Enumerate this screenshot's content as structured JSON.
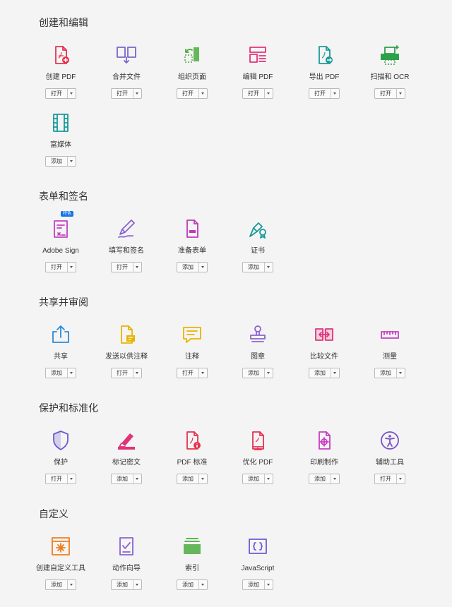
{
  "sections": [
    {
      "title": "创建和编辑",
      "tools": [
        {
          "label": "创建 PDF",
          "action": "打开",
          "icon": "create-pdf-icon"
        },
        {
          "label": "合并文件",
          "action": "打开",
          "icon": "combine-files-icon"
        },
        {
          "label": "组织页面",
          "action": "打开",
          "icon": "organize-pages-icon"
        },
        {
          "label": "编辑 PDF",
          "action": "打开",
          "icon": "edit-pdf-icon"
        },
        {
          "label": "导出 PDF",
          "action": "打开",
          "icon": "export-pdf-icon"
        },
        {
          "label": "扫描和 OCR",
          "action": "打开",
          "icon": "scan-ocr-icon"
        },
        {
          "label": "富媒体",
          "action": "添加",
          "icon": "rich-media-icon"
        }
      ]
    },
    {
      "title": "表单和签名",
      "tools": [
        {
          "label": "Adobe Sign",
          "action": "打开",
          "icon": "adobe-sign-icon",
          "badge": "特色"
        },
        {
          "label": "填写和签名",
          "action": "打开",
          "icon": "fill-sign-icon"
        },
        {
          "label": "准备表单",
          "action": "添加",
          "icon": "prepare-form-icon"
        },
        {
          "label": "证书",
          "action": "添加",
          "icon": "certificate-icon"
        }
      ]
    },
    {
      "title": "共享并审阅",
      "tools": [
        {
          "label": "共享",
          "action": "添加",
          "icon": "share-icon"
        },
        {
          "label": "发送以供注释",
          "action": "打开",
          "icon": "send-comments-icon"
        },
        {
          "label": "注释",
          "action": "打开",
          "icon": "comment-icon"
        },
        {
          "label": "图章",
          "action": "添加",
          "icon": "stamp-icon"
        },
        {
          "label": "比较文件",
          "action": "添加",
          "icon": "compare-files-icon"
        },
        {
          "label": "测量",
          "action": "添加",
          "icon": "measure-icon"
        }
      ]
    },
    {
      "title": "保护和标准化",
      "tools": [
        {
          "label": "保护",
          "action": "打开",
          "icon": "protect-shield-icon"
        },
        {
          "label": "标记密文",
          "action": "添加",
          "icon": "redact-icon"
        },
        {
          "label": "PDF 标准",
          "action": "添加",
          "icon": "pdf-standards-icon"
        },
        {
          "label": "优化 PDF",
          "action": "添加",
          "icon": "optimize-pdf-icon"
        },
        {
          "label": "印刷制作",
          "action": "添加",
          "icon": "print-production-icon"
        },
        {
          "label": "辅助工具",
          "action": "打开",
          "icon": "accessibility-icon"
        }
      ]
    },
    {
      "title": "自定义",
      "tools": [
        {
          "label": "创建自定义工具",
          "action": "添加",
          "icon": "create-custom-tool-icon"
        },
        {
          "label": "动作向导",
          "action": "添加",
          "icon": "action-wizard-icon"
        },
        {
          "label": "索引",
          "action": "添加",
          "icon": "index-icon"
        },
        {
          "label": "JavaScript",
          "action": "添加",
          "icon": "javascript-icon"
        }
      ]
    }
  ],
  "colors": {
    "create-pdf-icon": "#e5334f",
    "combine-files-icon": "#7a66c9",
    "organize-pages-icon": "#4caa3f",
    "edit-pdf-icon": "#e5337c",
    "export-pdf-icon": "#1b9a9a",
    "scan-ocr-icon": "#2ea04a",
    "rich-media-icon": "#16999b",
    "adobe-sign-icon": "#c43fbf",
    "fill-sign-icon": "#8a63d2",
    "prepare-form-icon": "#c039b5",
    "certificate-icon": "#17999a",
    "share-icon": "#2a8ad6",
    "send-comments-icon": "#e7b400",
    "comment-icon": "#e7b400",
    "stamp-icon": "#8a63d2",
    "compare-files-icon": "#e1337a",
    "measure-icon": "#c83ec4",
    "protect-shield-icon": "#6a5cd0",
    "redact-icon": "#e1337a",
    "pdf-standards-icon": "#e5334f",
    "optimize-pdf-icon": "#e5334f",
    "print-production-icon": "#c83ec4",
    "accessibility-icon": "#7a4fc9",
    "create-custom-tool-icon": "#ef7d1c",
    "action-wizard-icon": "#8a63d2",
    "index-icon": "#4caa3f",
    "javascript-icon": "#6a5cd0"
  }
}
